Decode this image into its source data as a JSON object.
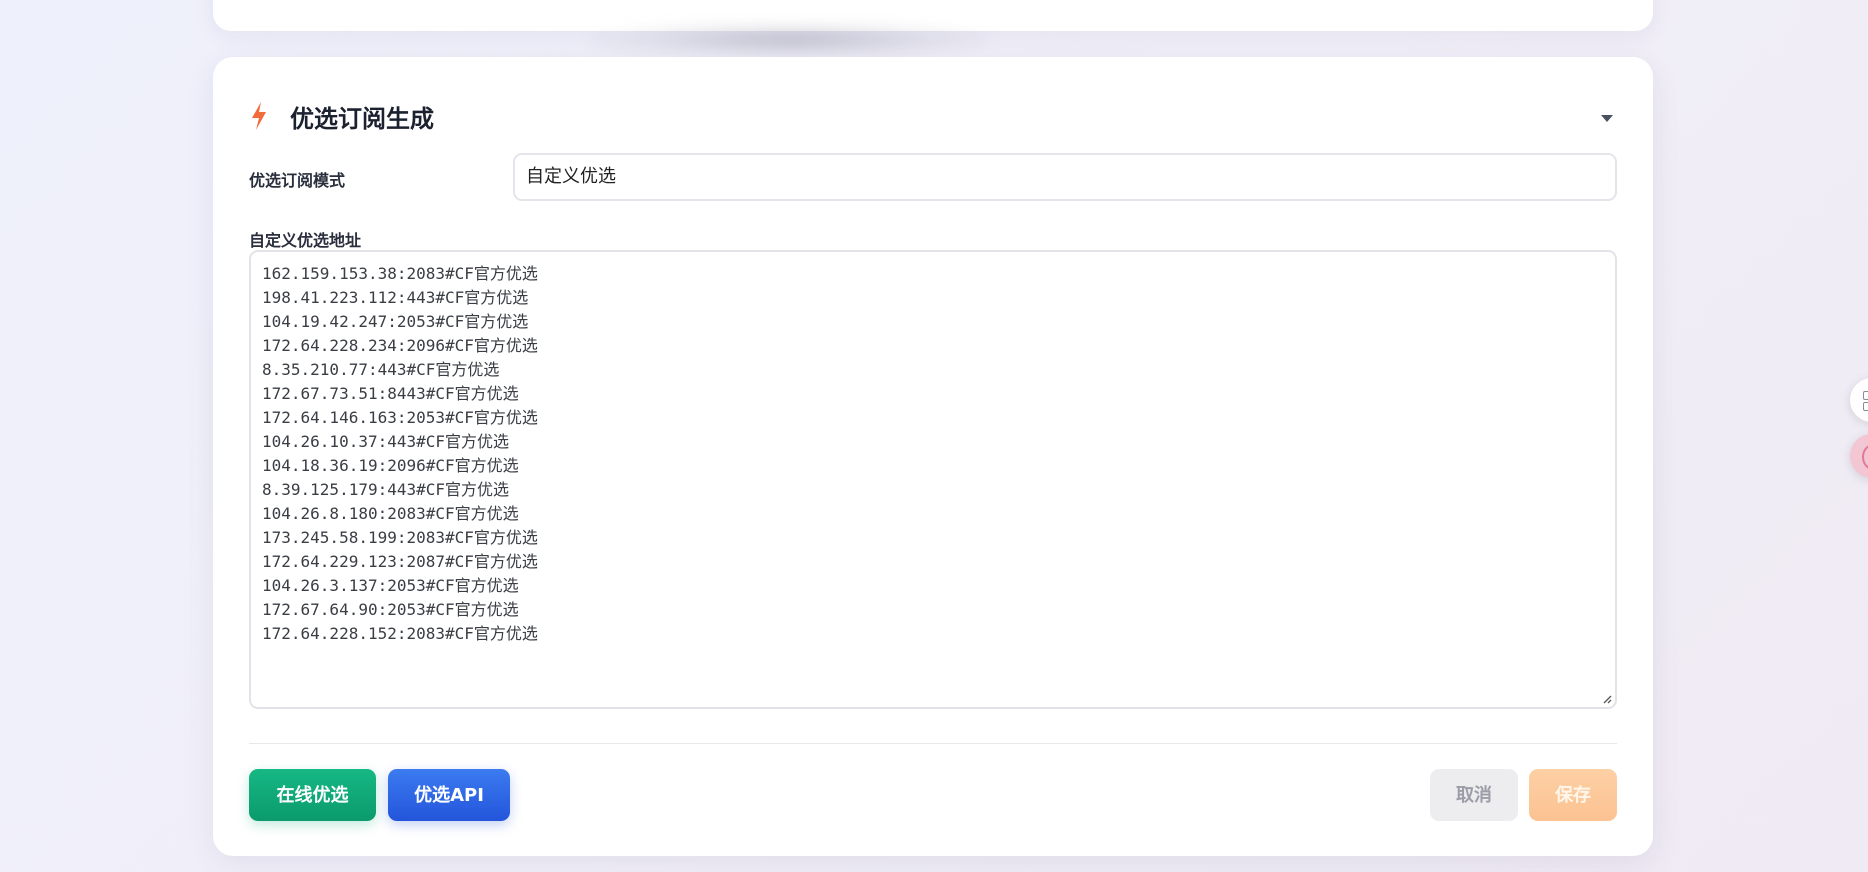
{
  "card": {
    "title": "优选订阅生成",
    "mode_label": "优选订阅模式",
    "mode_value": "自定义优选",
    "address_label": "自定义优选地址",
    "addresses": [
      "162.159.153.38:2083#CF官方优选",
      "198.41.223.112:443#CF官方优选",
      "104.19.42.247:2053#CF官方优选",
      "172.64.228.234:2096#CF官方优选",
      "8.35.210.77:443#CF官方优选",
      "172.67.73.51:8443#CF官方优选",
      "172.64.146.163:2053#CF官方优选",
      "104.26.10.37:443#CF官方优选",
      "104.18.36.19:2096#CF官方优选",
      "8.39.125.179:443#CF官方优选",
      "104.26.8.180:2083#CF官方优选",
      "173.245.58.199:2083#CF官方优选",
      "172.64.229.123:2087#CF官方优选",
      "104.26.3.137:2053#CF官方优选",
      "172.67.64.90:2053#CF官方优选",
      "172.64.228.152:2083#CF官方优选"
    ]
  },
  "buttons": {
    "online": "在线优选",
    "api": "优选API",
    "cancel": "取消",
    "save": "保存"
  },
  "icons": {
    "header": "lightning-bolt-icon",
    "collapse": "caret-down-icon",
    "side_top": "grid-icon",
    "side_bottom": "avatar-icon"
  },
  "colors": {
    "bolt": "#f26b3a",
    "online_button": "#12a877",
    "api_button": "#2e66e6",
    "save_button": "#fcc89c",
    "cancel_button": "#ededf0"
  }
}
